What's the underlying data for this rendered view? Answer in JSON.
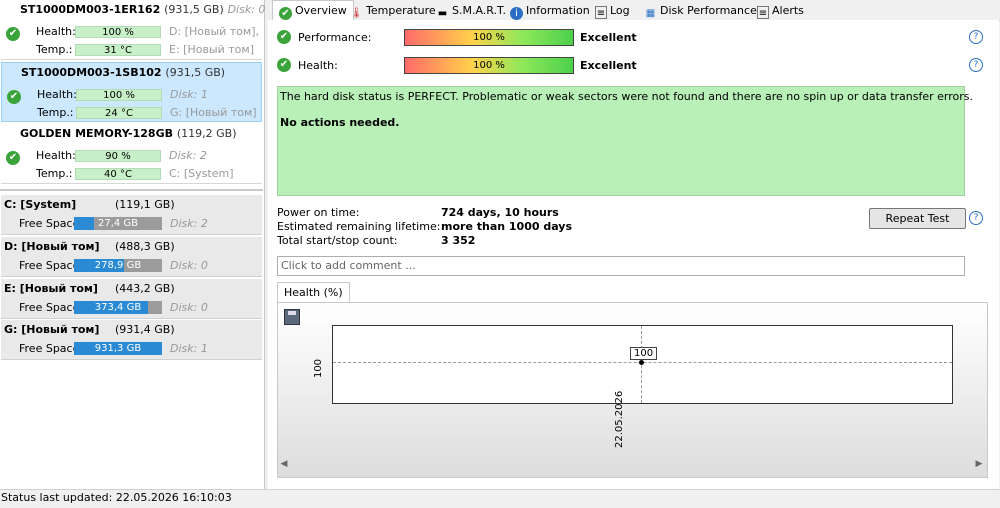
{
  "disks": [
    {
      "name": "ST1000DM003-1ER162",
      "size": "(931,5 GB)",
      "disk": "Disk: 0",
      "health": "100 %",
      "health_pct": 100,
      "temp": "31 °C",
      "temp_pct": 31,
      "vol1": "D: [Новый том],",
      "vol2": "E: [Новый том]",
      "selected": false
    },
    {
      "name": "ST1000DM003-1SB102",
      "size": "(931,5 GB)",
      "disk": "",
      "health": "100 %",
      "health_pct": 100,
      "temp": "24 °C",
      "temp_pct": 24,
      "vol1": "Disk: 1",
      "vol2": "G: [Новый том]",
      "selected": true
    },
    {
      "name": "GOLDEN MEMORY-128GB",
      "size": "(119,2 GB)",
      "disk": "",
      "health": "90 %",
      "health_pct": 90,
      "temp": "40 °C",
      "temp_pct": 40,
      "vol1": "Disk: 2",
      "vol2": "C: [System]",
      "selected": false
    }
  ],
  "labels": {
    "health": "Health:",
    "temp": "Temp.:",
    "free_space": "Free Space"
  },
  "volumes": [
    {
      "name": "C: [System]",
      "size": "(119,1 GB)",
      "free": "27,4 GB",
      "free_pct": 23,
      "disk": "Disk: 2"
    },
    {
      "name": "D: [Новый том]",
      "size": "(488,3 GB)",
      "free": "278,9 GB",
      "free_pct": 57,
      "disk": "Disk: 0"
    },
    {
      "name": "E: [Новый том]",
      "size": "(443,2 GB)",
      "free": "373,4 GB",
      "free_pct": 84,
      "disk": "Disk: 0"
    },
    {
      "name": "G: [Новый том]",
      "size": "(931,4 GB)",
      "free": "931,3 GB",
      "free_pct": 100,
      "disk": "Disk: 1"
    }
  ],
  "tabs": [
    "Overview",
    "Temperature",
    "S.M.A.R.T.",
    "Information",
    "Log",
    "Disk Performance",
    "Alerts"
  ],
  "overview": {
    "performance_label": "Performance:",
    "performance_value": "100 %",
    "performance_pct": 100,
    "performance_result": "Excellent",
    "health_label": "Health:",
    "health_value": "100 %",
    "health_pct": 100,
    "health_result": "Excellent",
    "status_text": "The hard disk status is PERFECT. Problematic or weak sectors were not found and there are no spin up or data transfer errors.",
    "status_action": "No actions needed.",
    "power_on_label": "Power on time:",
    "power_on_value": "724 days, 10 hours",
    "lifetime_label": "Estimated remaining lifetime:",
    "lifetime_value": "more than 1000 days",
    "startstop_label": "Total start/stop count:",
    "startstop_value": "3 352",
    "repeat_button": "Repeat Test",
    "comment_placeholder": "Click to add comment ...",
    "chart_tab": "Health (%)"
  },
  "chart_data": {
    "type": "line",
    "x": [
      "22.05.2026"
    ],
    "series": [
      {
        "values": [
          100
        ]
      }
    ],
    "xlabel": "",
    "ylabel": "",
    "y_tick": "100",
    "data_label": "100"
  },
  "status_bar": "Status last updated: 22.05.2026 16:10:03",
  "colors": {
    "ok": "#3aa33a",
    "volume_fill": "#2a8ad4",
    "status_box": "#b8f0b8",
    "selected": "#cce8ff"
  }
}
